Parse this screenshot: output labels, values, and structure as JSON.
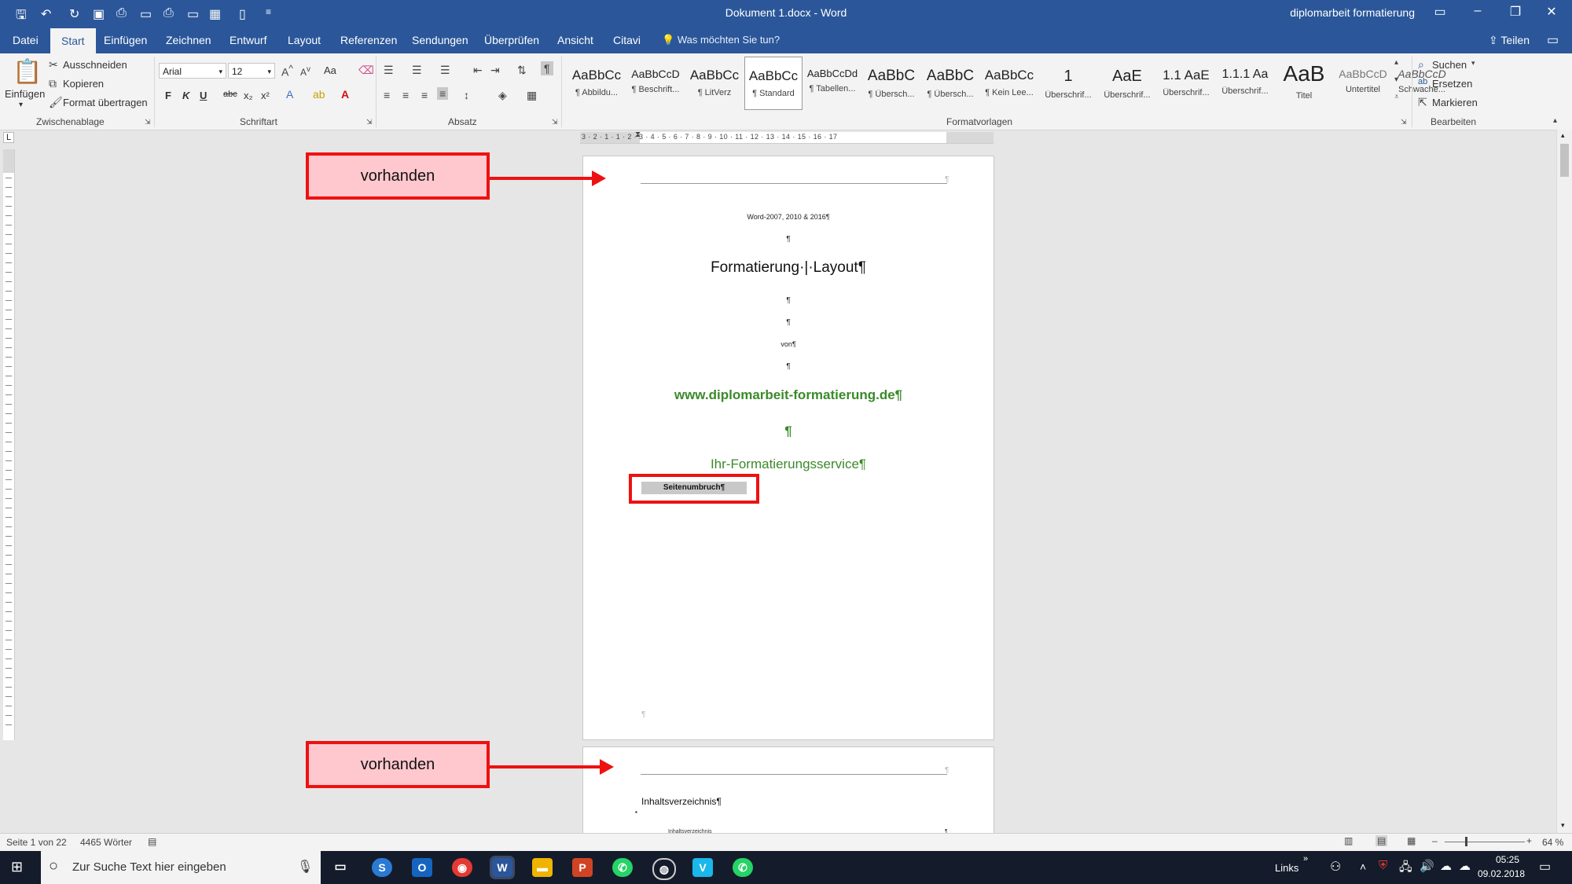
{
  "window": {
    "title": "Dokument 1.docx  -  Word",
    "account": "diplomarbeit formatierung"
  },
  "tabs": [
    "Datei",
    "Start",
    "Einfügen",
    "Zeichnen",
    "Entwurf",
    "Layout",
    "Referenzen",
    "Sendungen",
    "Überprüfen",
    "Ansicht",
    "Citavi"
  ],
  "tell_me": "Was möchten Sie tun?",
  "share": "Teilen",
  "ribbon": {
    "clipboard": {
      "paste": "Einfügen",
      "cut": "Ausschneiden",
      "copy": "Kopieren",
      "format_painter": "Format übertragen",
      "label": "Zwischenablage"
    },
    "font": {
      "name": "Arial",
      "size": "12",
      "bold": "F",
      "italic": "K",
      "underline": "U",
      "strike": "abc",
      "sub": "x₂",
      "sup": "x²",
      "case": "Aa",
      "label": "Schriftart"
    },
    "paragraph": {
      "label": "Absatz"
    },
    "styles": {
      "label": "Formatvorlagen",
      "items": [
        {
          "preview": "AaBbCc",
          "name": "¶ Abbildu..."
        },
        {
          "preview": "AaBbCcD",
          "name": "¶ Beschrift..."
        },
        {
          "preview": "AaBbCc",
          "name": "¶ LitVerz"
        },
        {
          "preview": "AaBbCc",
          "name": "¶ Standard"
        },
        {
          "preview": "AaBbCcDd",
          "name": "¶ Tabellen..."
        },
        {
          "preview": "AaBbC",
          "name": "¶ Übersch..."
        },
        {
          "preview": "AaBbC",
          "name": "¶ Übersch..."
        },
        {
          "preview": "AaBbCc",
          "name": "¶ Kein Lee..."
        },
        {
          "preview": "1",
          "name": "Überschrif..."
        },
        {
          "preview": "AaE",
          "name": "Überschrif..."
        },
        {
          "preview": "1.1 AaE",
          "name": "Überschrif..."
        },
        {
          "preview": "1.1.1 Aa",
          "name": "Überschrif..."
        },
        {
          "preview": "AaB",
          "name": "Titel"
        },
        {
          "preview": "AaBbCcD",
          "name": "Untertitel"
        },
        {
          "preview": "AaBbCcD",
          "name": "Schwache..."
        }
      ]
    },
    "editing": {
      "find": "Suchen",
      "replace": "Ersetzen",
      "select": "Markieren",
      "label": "Bearbeiten"
    }
  },
  "ruler": "3 · 2 · 1 · 1 · 2 · 3 · 4 · 5 · 6 · 7 · 8 · 9 · 10 · 11 · 12 · 13 · 14 · 15 · 16 · 17",
  "page1": {
    "header_mark": "¶",
    "line1": "Word-2007, 2010 & 2016¶",
    "p1": "¶",
    "title": "Formatierung·|·Layout¶",
    "p2": "¶",
    "p3": "¶",
    "by": "von¶",
    "p4": "¶",
    "url": "www.diplomarbeit-formatierung.de¶",
    "p5": "¶",
    "service": "Ihr-Formatierungsservice¶",
    "pagebreak": "Seitenumbruch",
    "pagebreak_mark": "¶",
    "bottom_mark": "¶"
  },
  "page2": {
    "header_mark": "¶",
    "toc_heading": "Inhaltsverzeichnis¶",
    "bullet": "▪",
    "toc_line_start": "Inhaltsverzeichnis",
    "toc_line_end": "¶"
  },
  "annotations": {
    "callout1": "vorhanden",
    "callout2": "vorhanden"
  },
  "status": {
    "page": "Seite 1 von 22",
    "words": "4465 Wörter",
    "zoom": "64 %"
  },
  "taskbar": {
    "search": "Zur Suche Text hier eingeben",
    "links": "Links",
    "time": "05:25",
    "date": "09.02.2018"
  },
  "colors": {
    "word_blue": "#2b579a",
    "url_green": "#3a8a2a",
    "callout_fill": "#ffc7ce",
    "callout_border": "#ee1111"
  }
}
